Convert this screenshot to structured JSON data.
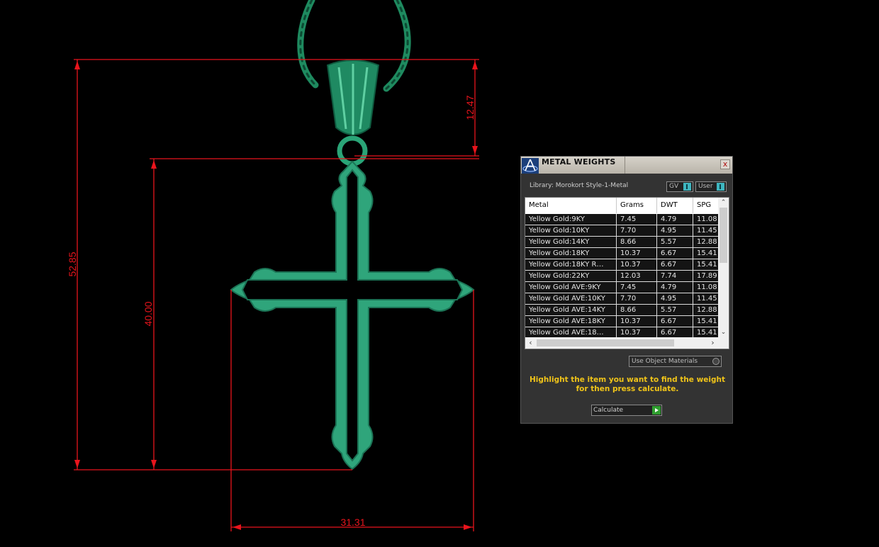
{
  "viewport": {
    "dimensions": [
      "52.85",
      "40.00",
      "12.47",
      "31.31"
    ],
    "colors": {
      "dimension": "#e8141c",
      "model": "#2fa57b",
      "chain": "#1e8a5f",
      "background": "#000000"
    }
  },
  "panel": {
    "title": "METAL WEIGHTS",
    "close_label": "x",
    "library": "Library: Morokort Style-1-Metal",
    "gv_label": "GV",
    "user_label": "User",
    "columns": [
      "Metal",
      "Grams",
      "DWT",
      "SPG"
    ],
    "rows": [
      [
        "Yellow Gold:9KY",
        "7.45",
        "4.79",
        "11.08"
      ],
      [
        "Yellow Gold:10KY",
        "7.70",
        "4.95",
        "11.45"
      ],
      [
        "Yellow Gold:14KY",
        "8.66",
        "5.57",
        "12.88"
      ],
      [
        "Yellow Gold:18KY",
        "10.37",
        "6.67",
        "15.41"
      ],
      [
        "Yellow Gold:18KY R…",
        "10.37",
        "6.67",
        "15.41"
      ],
      [
        "Yellow Gold:22KY",
        "12.03",
        "7.74",
        "17.89"
      ],
      [
        "Yellow Gold AVE:9KY",
        "7.45",
        "4.79",
        "11.08"
      ],
      [
        "Yellow Gold AVE:10KY",
        "7.70",
        "4.95",
        "11.45"
      ],
      [
        "Yellow Gold AVE:14KY",
        "8.66",
        "5.57",
        "12.88"
      ],
      [
        "Yellow Gold AVE:18KY",
        "10.37",
        "6.67",
        "15.41"
      ],
      [
        "Yellow Gold AVE:18…",
        "10.37",
        "6.67",
        "15.41"
      ]
    ],
    "use_object_materials": "Use Object Materials",
    "hint_line1": "Highlight the item you want to find the weight",
    "hint_line2": "for then press calculate.",
    "calculate_label": "Calculate"
  }
}
